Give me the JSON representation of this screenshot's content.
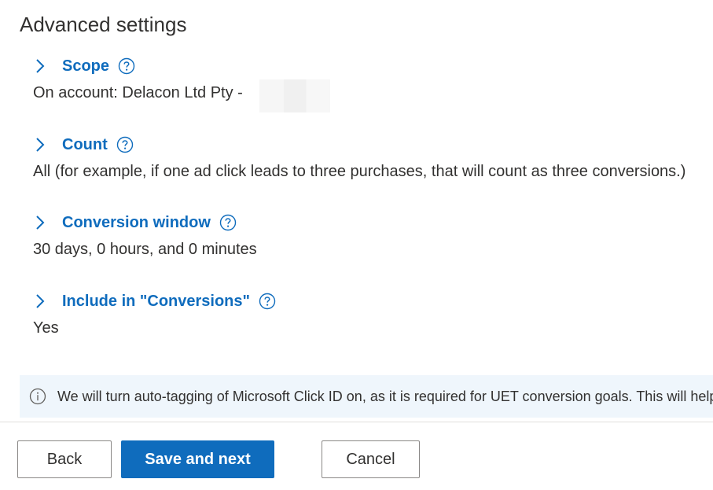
{
  "page": {
    "title": "Advanced settings"
  },
  "sections": [
    {
      "label": "Scope",
      "value": "On account: Delacon Ltd Pty -"
    },
    {
      "label": "Count",
      "value": "All (for example, if one ad click leads to three purchases, that will count as three conversions.)"
    },
    {
      "label": "Conversion window",
      "value": "30 days, 0 hours, and 0 minutes"
    },
    {
      "label": "Include in \"Conversions\"",
      "value": "Yes"
    }
  ],
  "info": {
    "icon": "info-icon",
    "text": "We will turn auto-tagging of Microsoft Click ID on, as it is required for UET conversion goals. This will help"
  },
  "actions": {
    "back_label": "Back",
    "save_next_label": "Save and next",
    "cancel_label": "Cancel"
  },
  "colors": {
    "accent": "#0f6cbd",
    "text": "#323130",
    "info_background": "#eff6fc",
    "border": "#8a8886"
  }
}
